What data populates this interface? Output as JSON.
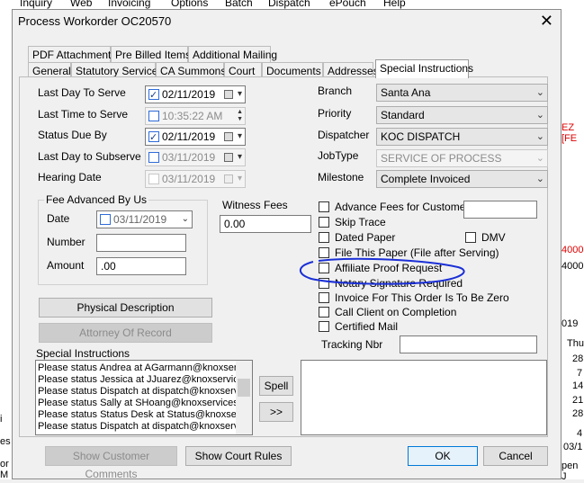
{
  "background": {
    "menu": [
      "Inquiry",
      "Web",
      "Invoicing",
      "Options",
      "Batch",
      "Dispatch",
      "ePouch",
      "Help"
    ],
    "right_fragments": [
      "EZ [FE",
      "4000.",
      "4000.",
      "019",
      "Thu",
      "28",
      "7",
      "14",
      "21",
      "28",
      "4",
      "03/1",
      "pen J"
    ],
    "left_fragments": [
      "i",
      "es",
      "or M"
    ]
  },
  "dialog": {
    "title": "Process Workorder OC20570",
    "close": "✕",
    "tabs_top": [
      "PDF Attachments",
      "Pre Billed Items",
      "Additional Mailing"
    ],
    "tabs_bottom": [
      "General",
      "Statutory Service",
      "CA Summons",
      "Court",
      "Documents",
      "Addresses",
      "Special Instructions"
    ]
  },
  "left": {
    "last_day_to_serve": {
      "label": "Last Day To Serve",
      "value": "02/11/2019",
      "checked": true
    },
    "last_time_to_serve": {
      "label": "Last Time to Serve",
      "value": "10:35:22 AM",
      "checked": false
    },
    "status_due_by": {
      "label": "Status Due By",
      "value": "02/11/2019",
      "checked": true
    },
    "last_day_to_subserve": {
      "label": "Last Day to Subserve",
      "value": "03/11/2019",
      "checked": false
    },
    "hearing_date": {
      "label": "Hearing Date",
      "value": "03/11/2019",
      "checked": false
    },
    "fee_group": {
      "title": "Fee Advanced By Us",
      "date_label": "Date",
      "date_value": "03/11/2019",
      "number_label": "Number",
      "number_value": "",
      "amount_label": "Amount",
      "amount_value": ".00"
    },
    "witness_fees": {
      "label": "Witness Fees",
      "value": "0.00"
    },
    "physical_description": "Physical Description",
    "attorney_of_record": "Attorney Of Record",
    "special_instructions_label": "Special Instructions",
    "special_instructions": [
      "Please status Andrea at AGarmann@knoxservi",
      "Please status Jessica at JJuarez@knoxservice",
      "Please status Dispatch at dispatch@knoxservi",
      "Please status Sally at SHoang@knoxservices.c",
      "Please status Status Desk at Status@knoxserv",
      "Please status Dispatch at dispatch@knoxservi"
    ],
    "spell": "Spell",
    "move": ">>"
  },
  "right": {
    "branch": {
      "label": "Branch",
      "value": "Santa Ana"
    },
    "priority": {
      "label": "Priority",
      "value": "Standard"
    },
    "dispatcher": {
      "label": "Dispatcher",
      "value": "KOC DISPATCH"
    },
    "jobtype": {
      "label": "JobType",
      "value": "SERVICE OF PROCESS"
    },
    "milestone": {
      "label": "Milestone",
      "value": "Complete Invoiced"
    },
    "checks": [
      {
        "label": "Advance Fees for Customer",
        "checked": false
      },
      {
        "label": "Skip Trace",
        "checked": false
      },
      {
        "label": "Dated Paper",
        "checked": false
      },
      {
        "label": "File This Paper (File after Serving)",
        "checked": false
      },
      {
        "label": "Affiliate Proof Request",
        "checked": false
      },
      {
        "label": "Notary Signature Required",
        "checked": false
      },
      {
        "label": "Invoice For This Order Is To Be Zero",
        "checked": false
      },
      {
        "label": "Call Client on Completion",
        "checked": false
      },
      {
        "label": "Certified Mail",
        "checked": false
      }
    ],
    "advance_fee_value": "",
    "dmv": {
      "label": "DMV",
      "checked": false
    },
    "tracking": {
      "label": "Tracking Nbr",
      "value": ""
    }
  },
  "footer": {
    "show_customer_comments": "Show Customer Comments",
    "show_court_rules": "Show Court Rules",
    "ok": "OK",
    "cancel": "Cancel"
  },
  "colors": {
    "annotation": "#1a2fd6",
    "active_check": "#2f6cd9",
    "primary_border": "#0078d7"
  }
}
